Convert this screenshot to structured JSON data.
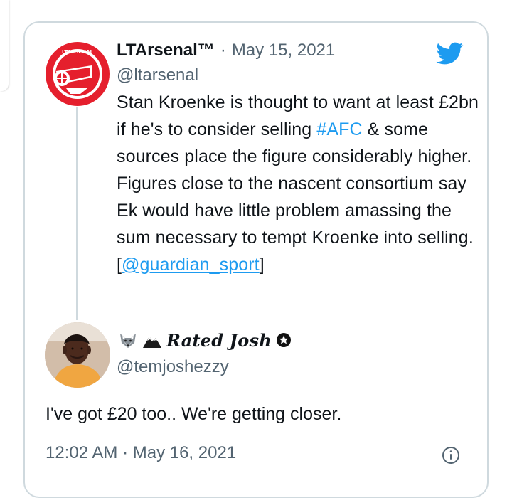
{
  "tweet": {
    "author": {
      "display_name": "LTArsenal™",
      "handle": "@ltarsenal",
      "date": "May 15, 2021",
      "separator": "·"
    },
    "text_parts": [
      {
        "text": "Stan Kroenke is thought to want at least £2bn if he's to consider selling ",
        "type": "plain"
      },
      {
        "text": "#AFC",
        "type": "hashtag"
      },
      {
        "text": " & some sources place the figure considerably higher. Figures close to the nascent consortium say Ek would have little problem amassing the sum necessary to tempt Kroenke into selling. [",
        "type": "plain"
      },
      {
        "text": "@guardian_sport",
        "type": "mention"
      },
      {
        "text": "]",
        "type": "plain"
      }
    ]
  },
  "reply": {
    "author": {
      "display_name": "Rated Josh",
      "handle": "@temjoshezzy",
      "emoji_1": "fox-face",
      "emoji_2": "snowcap-mountain"
    },
    "text": "I've got £20 too.. We're getting closer.",
    "timestamp": "12:02 AM · May 16, 2021"
  },
  "theme": {
    "twitter_blue": "#1d9bf0",
    "arsenal_red": "#e51f2d",
    "text_primary": "#0f1419",
    "text_secondary": "#536471",
    "border": "#cfd9de"
  },
  "icons": {
    "logo": "twitter-bird-icon",
    "info": "info-circle-icon",
    "verified_badge": "star-badge-icon"
  }
}
